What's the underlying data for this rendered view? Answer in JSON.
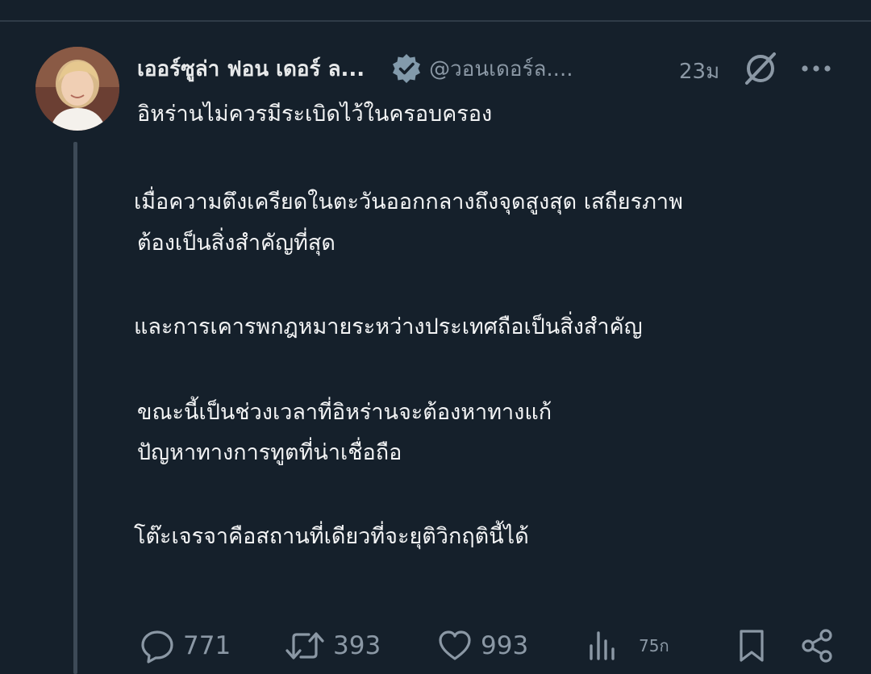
{
  "post": {
    "author_name": "เออร์ซูล่า ฟอน เดอร์ ล...",
    "handle": "@วอนเดอร์ล....",
    "time": "23ม",
    "body": {
      "line1": "อิหร่านไม่ควรมีระเบิดไว้ในครอบครอง",
      "line2": "เมื่อความตึงเครียดในตะวันออกกลางถึงจุดสูงสุด เสถียรภาพ",
      "line3": "ต้องเป็นสิ่งสำคัญที่สุด",
      "line4": "และการเคารพกฎหมายระหว่างประเทศถือเป็นสิ่งสำคัญ",
      "line5": "ขณะนี้เป็นช่วงเวลาที่อิหร่านจะต้องหาทางแก้",
      "line6": "ปัญหาทางการทูตที่น่าเชื่อถือ",
      "line7": "โต๊ะเจรจาคือสถานที่เดียวที่จะยุติวิกฤตินี้ได้"
    }
  },
  "actions": {
    "replies": "771",
    "reposts": "393",
    "likes": "993",
    "views": "75ก"
  },
  "icons": {
    "verified": "verified-badge-icon",
    "grok": "grok-slash-icon",
    "more": "more-dots-icon",
    "reply": "reply-bubble-icon",
    "repost": "repost-arrows-icon",
    "like": "heart-icon",
    "views": "views-bars-icon",
    "bookmark": "bookmark-icon",
    "share": "share-icon"
  },
  "colors": {
    "background": "#15202b",
    "text": "#e7e9ea",
    "muted": "#8b98a5",
    "verified_badge": "#829aab"
  }
}
